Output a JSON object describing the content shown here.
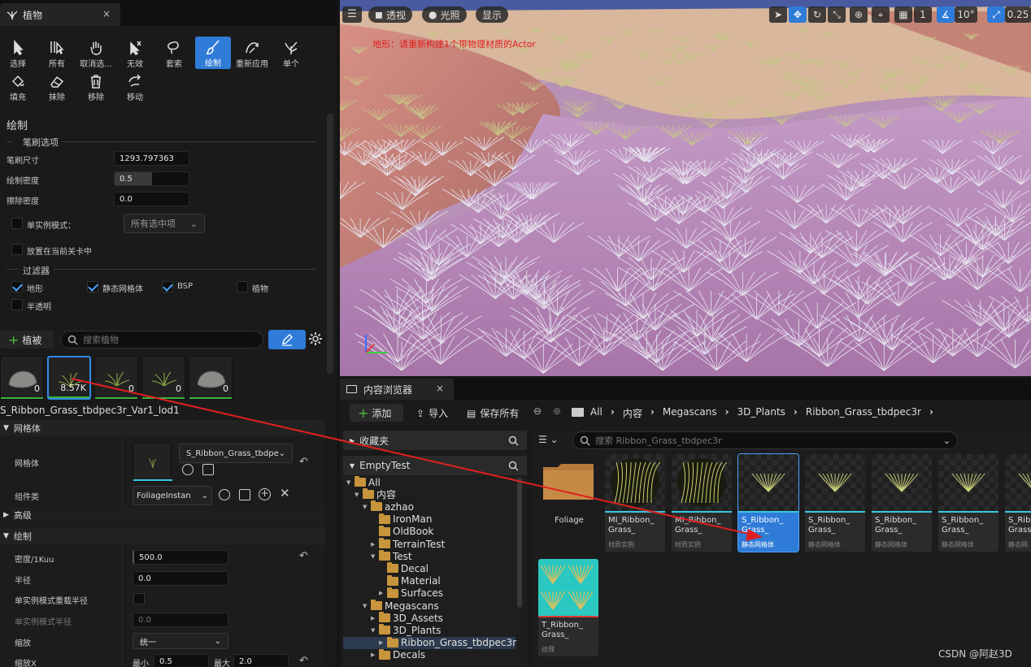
{
  "foliage_panel": {
    "tab_title": "植物",
    "tab_close": "×",
    "tools": [
      {
        "label": "选择",
        "icon": "cursor-icon"
      },
      {
        "label": "所有",
        "icon": "select-all-icon"
      },
      {
        "label": "取消选...",
        "icon": "hand-icon"
      },
      {
        "label": "无效",
        "icon": "invalid-icon"
      },
      {
        "label": "套索",
        "icon": "lasso-icon"
      },
      {
        "label": "绘制",
        "icon": "paint-brush-icon",
        "active": true
      },
      {
        "label": "重新应用",
        "icon": "reapply-icon"
      },
      {
        "label": "单个",
        "icon": "single-plant-icon"
      },
      {
        "label": "填充",
        "icon": "fill-icon"
      },
      {
        "label": "抹除",
        "icon": "eraser-icon"
      },
      {
        "label": "移除",
        "icon": "trash-icon"
      },
      {
        "label": "移动",
        "icon": "move-icon"
      }
    ],
    "paint_title": "绘制",
    "brush_options_title": "笔刷选项",
    "brush_size_label": "笔刷尺寸",
    "brush_size_value": "1293.797363",
    "paint_density_label": "绘制密度",
    "paint_density_value": "0.5",
    "paint_density_fraction": 0.5,
    "erase_density_label": "擦除密度",
    "erase_density_value": "0.0",
    "single_instance_label": "单实例模式：",
    "single_instance_dropdown": "所有选中项",
    "place_in_level_label": "放置在当前关卡中",
    "filters_title": "过滤器",
    "filters": [
      {
        "label": "地形",
        "checked": true
      },
      {
        "label": "静态网格体",
        "checked": true
      },
      {
        "label": "BSP",
        "checked": true
      },
      {
        "label": "植物",
        "checked": false
      },
      {
        "label": "半透明",
        "checked": false
      }
    ],
    "add_foliage_label": "植被",
    "search_placeholder": "搜索植物",
    "thumbnails": [
      {
        "count": "0",
        "kind": "rock"
      },
      {
        "count": "8.57K",
        "kind": "grass",
        "selected": true
      },
      {
        "count": "0",
        "kind": "grass"
      },
      {
        "count": "0",
        "kind": "grass"
      },
      {
        "count": "0",
        "kind": "rock"
      }
    ],
    "selected_mesh_name": "S_Ribbon_Grass_tbdpec3r_Var1_lod1",
    "mesh_section": "网格体",
    "mesh_label": "网格体",
    "mesh_dropdown": "S_Ribbon_Grass_tbdpe",
    "component_class_label": "组件类",
    "component_class_dropdown": "FoliageInstan",
    "advanced_section": "高级",
    "painting_section": "绘制",
    "density_label": "密度/1Kuu",
    "density_value": "500.0",
    "radius_label": "半径",
    "radius_value": "0.0",
    "single_override_label": "单实例模式重载半径",
    "single_radius_label": "单实例模式半径",
    "single_radius_value": "0.0",
    "scaling_label": "缩放",
    "scaling_dropdown": "统一",
    "scale_x_label": "缩放X",
    "min_label": "最小",
    "min_value": "0.5",
    "max_label": "最大",
    "max_value": "2.0"
  },
  "viewport": {
    "perspective_label": "透视",
    "lighting_label": "光照",
    "show_label": "显示",
    "grid_value": "1",
    "angle_value": "10°",
    "scale_value": "0.25",
    "warning_text": "地形：请重新构建1个带物理材质的Actor",
    "colors": {
      "sand": "#c98379",
      "pink": "#b891b6",
      "sky": "#4a5aa0",
      "warning": "#e02020"
    }
  },
  "content_browser": {
    "tab_title": "内容浏览器",
    "tab_close": "×",
    "add_label": "添加",
    "import_label": "导入",
    "save_all_label": "保存所有",
    "breadcrumbs": [
      "All",
      "内容",
      "Megascans",
      "3D_Plants",
      "Ribbon_Grass_tbdpec3r"
    ],
    "search_placeholder": "搜索 Ribbon_Grass_tbdpec3r",
    "favorites_label": "收藏夹",
    "project_label": "EmptyTest",
    "tree": [
      {
        "label": "All",
        "depth": 0,
        "expanded": true
      },
      {
        "label": "内容",
        "depth": 1,
        "expanded": true
      },
      {
        "label": "azhao",
        "depth": 2,
        "expanded": true
      },
      {
        "label": "IronMan",
        "depth": 3
      },
      {
        "label": "OldBook",
        "depth": 3
      },
      {
        "label": "TerrainTest",
        "depth": 3,
        "collapsed": true
      },
      {
        "label": "Test",
        "depth": 3,
        "expanded": true
      },
      {
        "label": "Decal",
        "depth": 4
      },
      {
        "label": "Material",
        "depth": 4
      },
      {
        "label": "Surfaces",
        "depth": 4,
        "collapsed": true
      },
      {
        "label": "Megascans",
        "depth": 2,
        "expanded": true
      },
      {
        "label": "3D_Assets",
        "depth": 3,
        "collapsed": true
      },
      {
        "label": "3D_Plants",
        "depth": 3,
        "expanded": true
      },
      {
        "label": "Ribbon_Grass_tbdpec3r",
        "depth": 4,
        "collapsed": true,
        "selected": true
      },
      {
        "label": "Decals",
        "depth": 3,
        "collapsed": true
      }
    ],
    "assets": [
      {
        "name": "Foliage",
        "type": "",
        "kind": "folder"
      },
      {
        "name": "MI_Ribbon_\nGrass_",
        "type": "材质实例",
        "kind": "material"
      },
      {
        "name": "MI_Ribbon_\nGrass_",
        "type": "材质实例",
        "kind": "material"
      },
      {
        "name": "S_Ribbon_\nGrass_",
        "type": "静态网格体",
        "kind": "mesh",
        "selected": true
      },
      {
        "name": "S_Ribbon_\nGrass_",
        "type": "静态网格体",
        "kind": "mesh"
      },
      {
        "name": "S_Ribbon_\nGrass_",
        "type": "静态网格体",
        "kind": "mesh"
      },
      {
        "name": "S_Ribbon_\nGrass_",
        "type": "静态网格体",
        "kind": "mesh"
      },
      {
        "name": "S_Ribb\nGrass",
        "type": "静态网",
        "kind": "mesh"
      },
      {
        "name": "T_Ribbon_\nGrass_",
        "type": "纹理",
        "kind": "texture"
      }
    ]
  },
  "watermark": "CSDN @阿赵3D",
  "annotation_color": "#e02020"
}
